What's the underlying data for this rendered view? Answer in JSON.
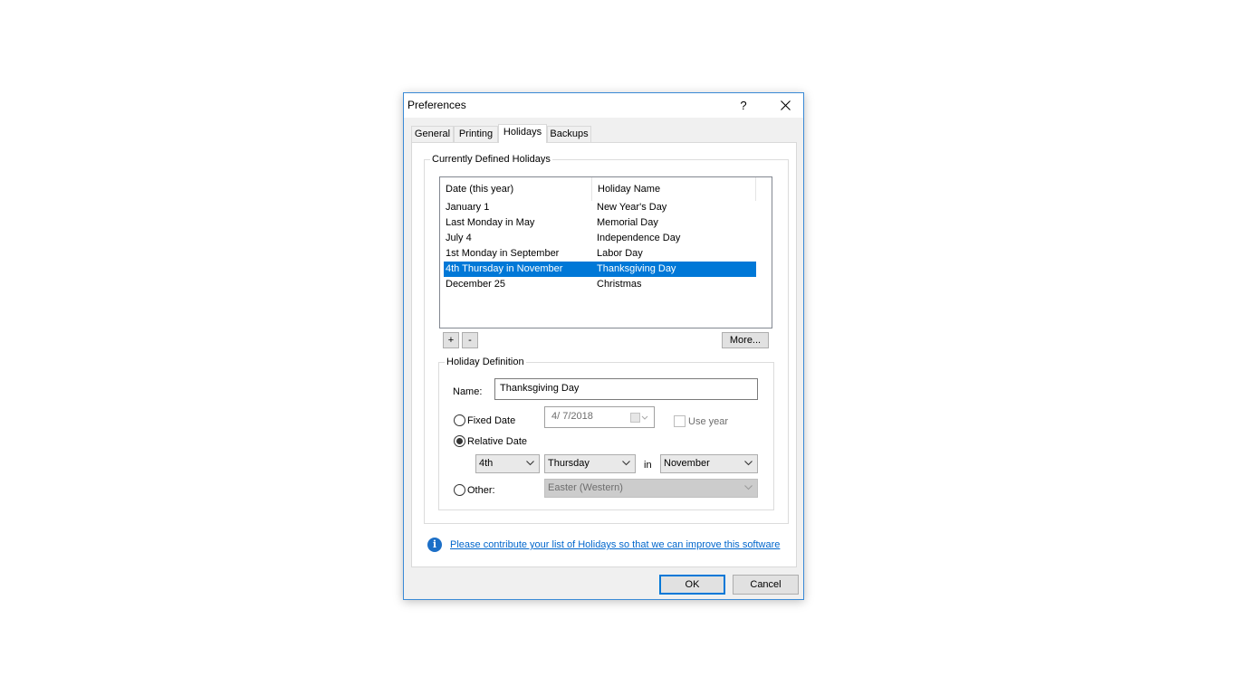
{
  "window": {
    "title": "Preferences",
    "help_label": "?"
  },
  "tabs": [
    {
      "label": "General"
    },
    {
      "label": "Printing"
    },
    {
      "label": "Holidays",
      "active": true
    },
    {
      "label": "Backups"
    }
  ],
  "holidays_group": {
    "label": "Currently Defined Holidays",
    "columns": [
      "Date (this year)",
      "Holiday Name"
    ],
    "rows": [
      {
        "date": "January 1",
        "name": "New Year's Day"
      },
      {
        "date": "Last Monday in May",
        "name": "Memorial Day"
      },
      {
        "date": "July 4",
        "name": "Independence Day"
      },
      {
        "date": "1st Monday in September",
        "name": "Labor Day"
      },
      {
        "date": "4th Thursday in November",
        "name": "Thanksgiving Day",
        "selected": true
      },
      {
        "date": "December 25",
        "name": "Christmas"
      }
    ],
    "add_label": "+",
    "remove_label": "-",
    "more_label": "More..."
  },
  "definition": {
    "label": "Holiday Definition",
    "name_label": "Name:",
    "name_value": "Thanksgiving Day",
    "fixed_label": "Fixed Date",
    "fixed_date_value": "4/  7/2018",
    "use_year_label": "Use year",
    "relative_label": "Relative Date",
    "relative_ordinal": "4th",
    "relative_weekday": "Thursday",
    "in_label": "in",
    "relative_month": "November",
    "other_label": "Other:",
    "other_value": "Easter (Western)",
    "selected_option": "relative"
  },
  "info_link": "Please contribute your list of Holidays so that we can improve this software",
  "footer": {
    "ok_label": "OK",
    "cancel_label": "Cancel"
  },
  "colors": {
    "selection": "#0078d7",
    "link": "#0066cc",
    "border_accent": "#3a8ad6"
  }
}
